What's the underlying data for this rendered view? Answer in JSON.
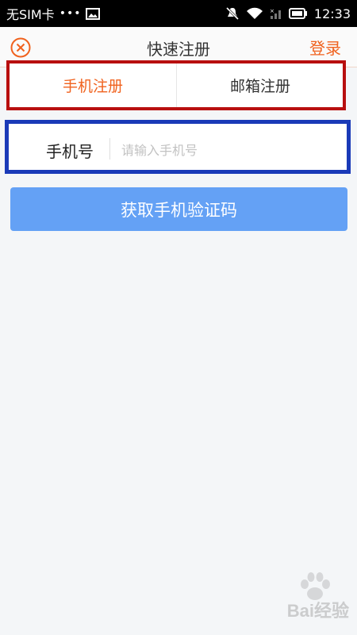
{
  "status_bar": {
    "carrier": "无SIM卡",
    "dots": "•••",
    "time": "12:33",
    "icons": [
      "image-icon",
      "mute-icon",
      "wifi-icon",
      "signal-icon",
      "battery-icon"
    ]
  },
  "header": {
    "title": "快速注册",
    "login": "登录",
    "close_icon": "close-circle-icon"
  },
  "tabs": [
    {
      "label": "手机注册",
      "active": true
    },
    {
      "label": "邮箱注册",
      "active": false
    }
  ],
  "phone_field": {
    "label": "手机号",
    "value": "",
    "placeholder": "请输入手机号"
  },
  "primary_button": {
    "label": "获取手机验证码"
  },
  "watermark": {
    "text": "Bai经验"
  },
  "colors": {
    "accent": "#f0621e",
    "button": "#64a1f5",
    "highlight_red": "#b80f0f",
    "highlight_blue": "#1a3ab8"
  }
}
